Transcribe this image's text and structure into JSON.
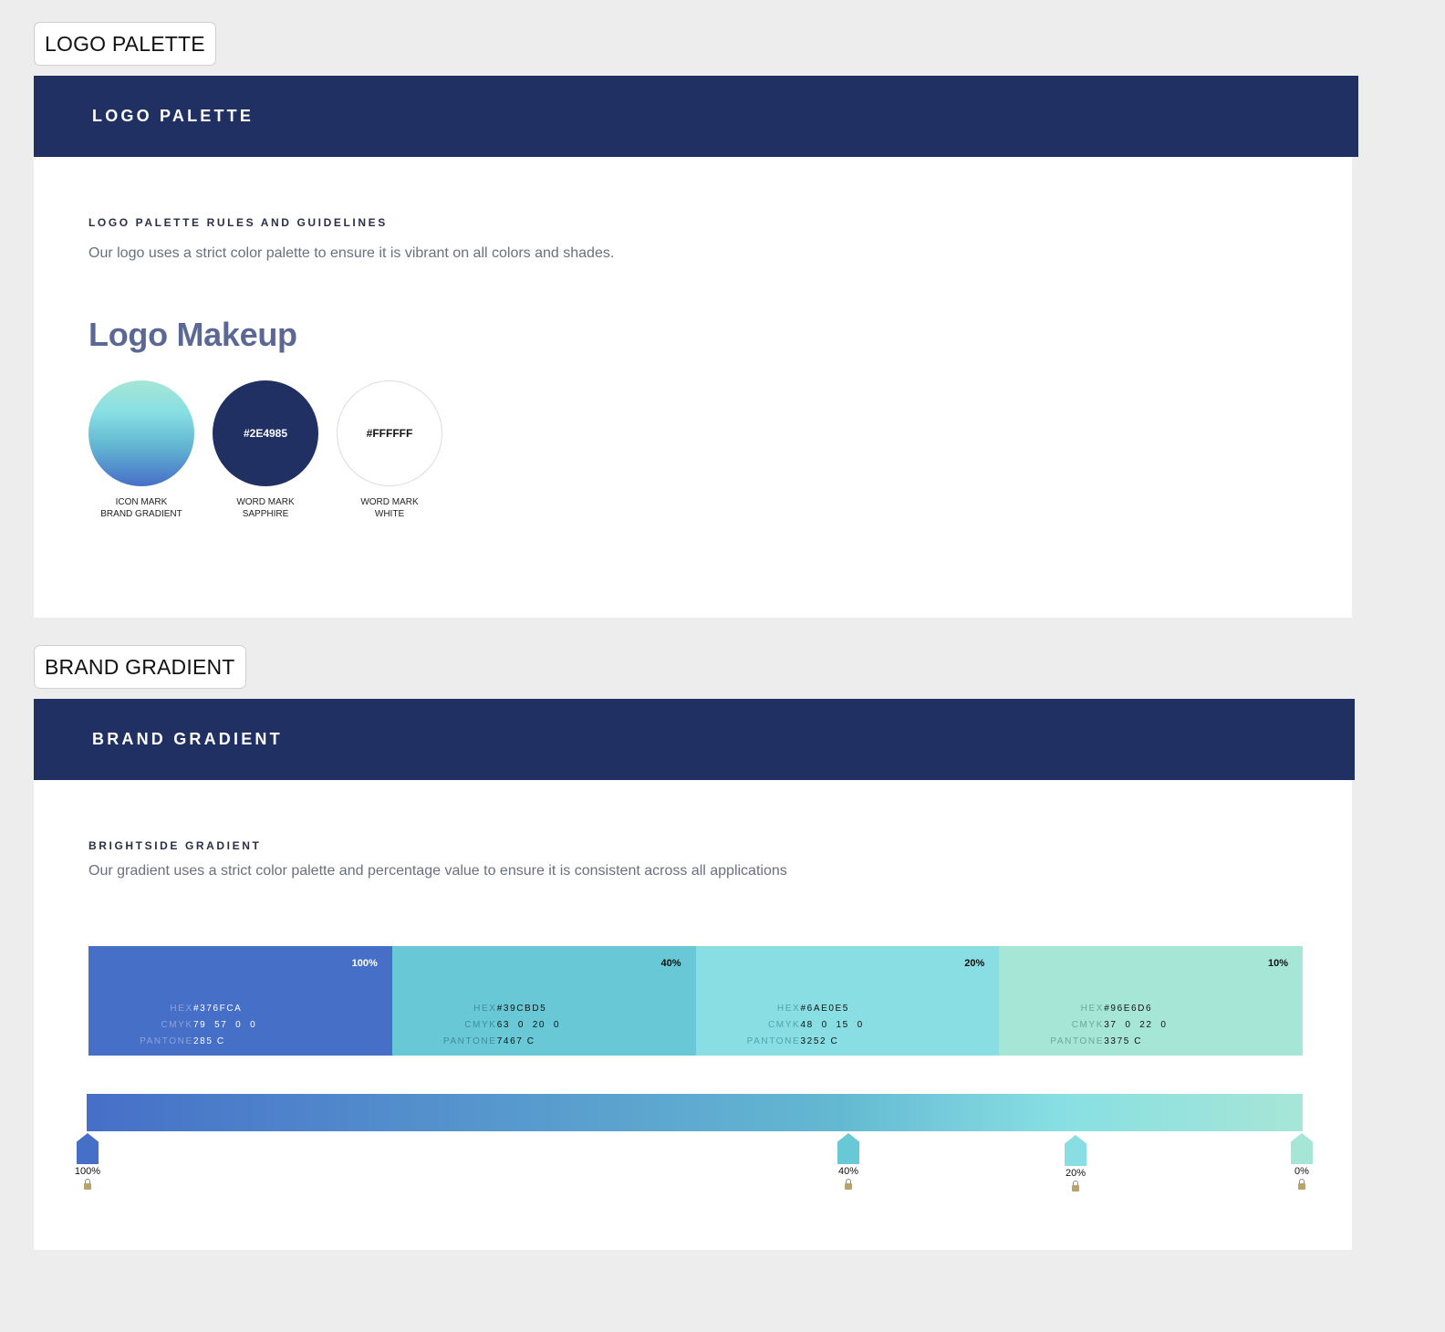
{
  "logo_palette": {
    "frame_label": "LOGO PALETTE",
    "header_title": "LOGO PALETTE",
    "eyebrow": "LOGO PALETTE RULES AND GUIDELINES",
    "description": "Our logo uses a strict color palette to ensure it is vibrant on all colors and shades.",
    "makeup_title": "Logo Makeup",
    "swatches": [
      {
        "hex": "",
        "line1": "ICON MARK",
        "line2": "BRAND GRADIENT",
        "fill": "linear-gradient(#a6e6d6, #88dfe3 30%, #64b9d2 60%, #466fc8)"
      },
      {
        "hex": "#2E4985",
        "line1": "WORD MARK",
        "line2": "SAPPHIRE",
        "fill": "#213063"
      },
      {
        "hex": "#FFFFFF",
        "line1": "WORD MARK",
        "line2": "WHITE",
        "fill": "#ffffff"
      }
    ]
  },
  "brand_gradient": {
    "frame_label": "BRAND GRADIENT",
    "header_title": "BRAND GRADIENT",
    "eyebrow": "BRIGHTSIDE GRADIENT",
    "description": "Our gradient uses a strict color palette and percentage value to ensure it is consistent across all applications",
    "spec_keys": {
      "hex": "HEX",
      "cmyk": "CMYK",
      "pantone": "PANTONE"
    },
    "stops": [
      {
        "percent": "100%",
        "hex": "#376FCA",
        "cmyk": "79  57  0  0",
        "pantone": "285 C",
        "color": "#466fc8"
      },
      {
        "percent": "40%",
        "hex": "#39CBD5",
        "cmyk": "63  0  20  0",
        "pantone": "7467 C",
        "color": "#68c8d5"
      },
      {
        "percent": "20%",
        "hex": "#6AE0E5",
        "cmyk": "48  0  15  0",
        "pantone": "3252 C",
        "color": "#88dee3"
      },
      {
        "percent": "10%",
        "hex": "#96E6D6",
        "cmyk": "37  0  22  0",
        "pantone": "3375 C",
        "color": "#a6e6d6"
      }
    ],
    "markers": [
      "100%",
      "40%",
      "20%",
      "0%"
    ]
  }
}
